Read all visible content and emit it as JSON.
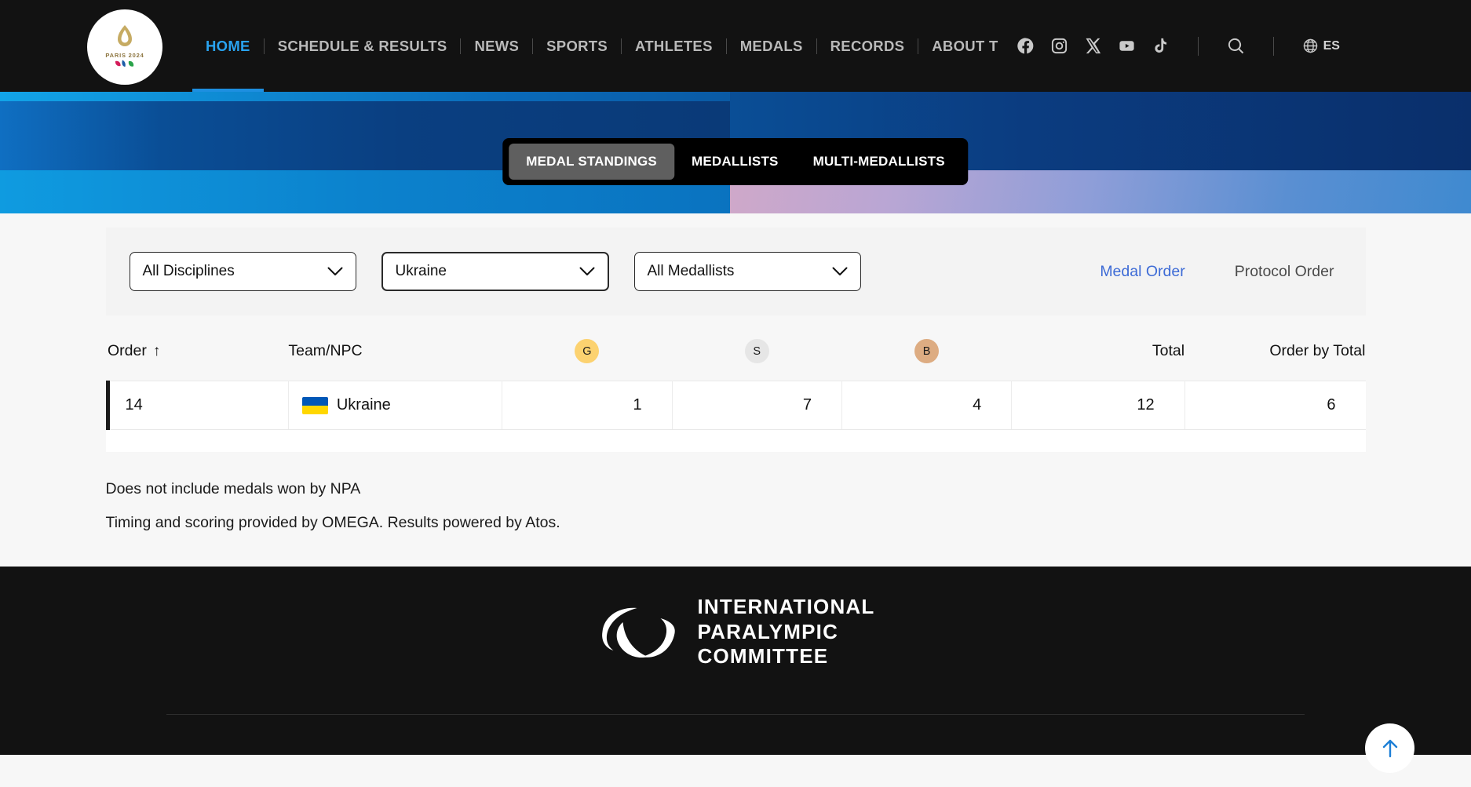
{
  "header": {
    "logo": {
      "name": "paris-2024-logo",
      "caption": "PARIS 2024"
    },
    "nav_items": [
      {
        "label": "HOME",
        "active": true
      },
      {
        "label": "SCHEDULE & RESULTS",
        "active": false
      },
      {
        "label": "NEWS",
        "active": false
      },
      {
        "label": "SPORTS",
        "active": false
      },
      {
        "label": "ATHLETES",
        "active": false
      },
      {
        "label": "MEDALS",
        "active": false
      },
      {
        "label": "RECORDS",
        "active": false
      },
      {
        "label": "ABOUT T",
        "active": false
      }
    ],
    "social": [
      {
        "icon": "facebook-icon"
      },
      {
        "icon": "instagram-icon"
      },
      {
        "icon": "x-twitter-icon"
      },
      {
        "icon": "youtube-icon"
      },
      {
        "icon": "tiktok-icon"
      }
    ],
    "search_icon": "search-icon",
    "language": {
      "icon": "globe-icon",
      "label": "ES"
    },
    "accent_color": "#29a3f0",
    "background_color": "#121212"
  },
  "hero": {
    "tabs": [
      {
        "label": "MEDAL STANDINGS",
        "selected": true
      },
      {
        "label": "MEDALLISTS",
        "selected": false
      },
      {
        "label": "MULTI-MEDALLISTS",
        "selected": false
      }
    ]
  },
  "filters": {
    "discipline": {
      "value": "All Disciplines",
      "focused": false
    },
    "npc": {
      "value": "Ukraine",
      "focused": true
    },
    "medallists": {
      "value": "All Medallists",
      "focused": false
    },
    "order_links": [
      {
        "label": "Medal Order",
        "active": true
      },
      {
        "label": "Protocol Order",
        "active": false
      }
    ]
  },
  "table": {
    "columns": [
      {
        "key": "order",
        "label": "Order",
        "sort": "↑"
      },
      {
        "key": "team",
        "label": "Team/NPC"
      },
      {
        "key": "gold",
        "label": "G",
        "badge": "gold"
      },
      {
        "key": "silver",
        "label": "S",
        "badge": "silver"
      },
      {
        "key": "bronze",
        "label": "B",
        "badge": "bronze"
      },
      {
        "key": "total",
        "label": "Total"
      },
      {
        "key": "order_by_total",
        "label": "Order by Total"
      }
    ],
    "rows": [
      {
        "order": "14",
        "team": "Ukraine",
        "flag": "ukraine-flag",
        "gold": "1",
        "silver": "7",
        "bronze": "4",
        "total": "12",
        "order_by_total": "6"
      }
    ],
    "badge_colors": {
      "gold": "#fcd270",
      "silver": "#e6e6e6",
      "bronze": "#ddac82"
    }
  },
  "notes": [
    "Does not include medals won by NPA",
    "Timing and scoring provided by OMEGA. Results powered by Atos."
  ],
  "footer": {
    "logo_icon": "ipc-agitos-logo",
    "name_line1": "INTERNATIONAL",
    "name_line2": "PARALYMPIC",
    "name_line3": "COMMITTEE"
  },
  "scroll_top_button": {
    "icon": "arrow-up-icon"
  }
}
